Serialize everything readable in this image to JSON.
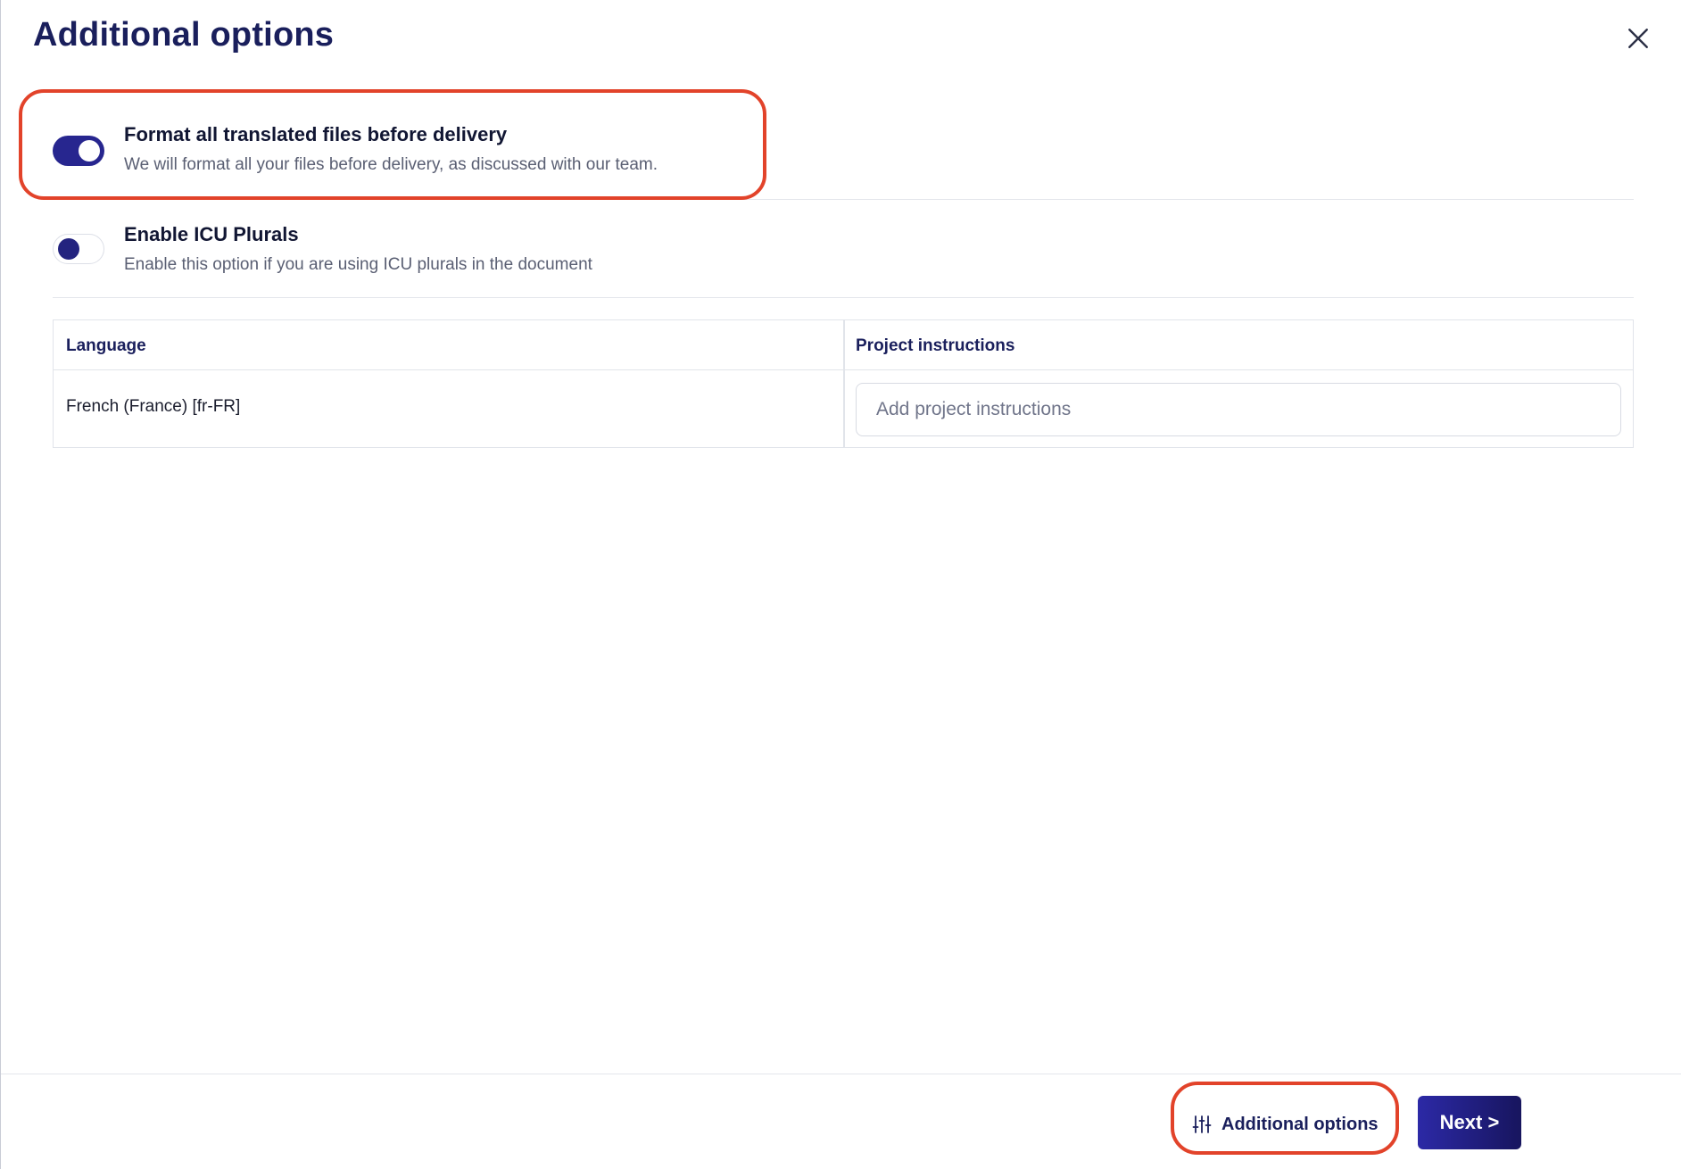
{
  "dialog": {
    "title": "Additional options",
    "close_icon": "close-icon"
  },
  "options": [
    {
      "title": "Format all translated files before delivery",
      "description": "We will format all your files before delivery, as discussed with our team.",
      "enabled": true
    },
    {
      "title": "Enable ICU Plurals",
      "description": "Enable this option if you are using ICU plurals in the document",
      "enabled": false
    }
  ],
  "table": {
    "headers": [
      "Language",
      "Project instructions"
    ],
    "rows": [
      {
        "language": "French (France) [fr-FR]",
        "instructions_value": "",
        "instructions_placeholder": "Add project instructions"
      }
    ]
  },
  "footer": {
    "options_label": "Additional options",
    "options_icon": "sliders-icon",
    "next_label": "Next >"
  },
  "colors": {
    "accent": "#27268f",
    "title": "#1a1f5c",
    "highlight": "#e2432a"
  }
}
